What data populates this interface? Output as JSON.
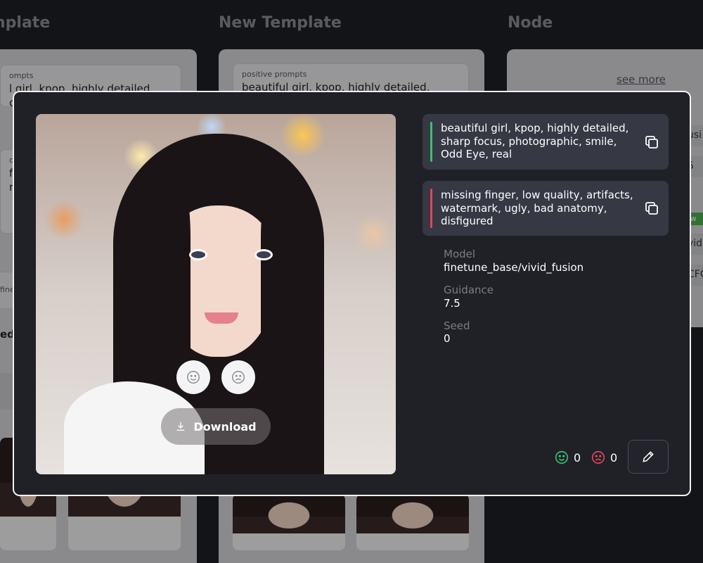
{
  "columns": {
    "col1_title": "nplate",
    "col2_title": "New Template",
    "col3_title": "Node",
    "col1_field1_label": "ompts",
    "col1_field1_value": "l girl, kpop, highly detailed,",
    "col1_field1_value2": "cus",
    "col1_field2_label": "om",
    "col1_field2_value": "fin",
    "col1_field2_value2": "rk,",
    "col1_field3_label": "fine",
    "col1_bold_label": "ed",
    "col2_field1_label": "positive prompts",
    "col2_field1_value": "beautiful girl, kpop, highly detailed,",
    "col3_see_more": "see more",
    "col3_pill1": "usi",
    "col3_pill2": "5",
    "col3_new_badge": "ew",
    "col3_pill3": "vid",
    "col3_pill4": "CFC"
  },
  "modal": {
    "positive_prompt": "beautiful girl, kpop, highly detailed, sharp focus, photographic, smile, Odd Eye, real",
    "negative_prompt": "missing finger, low quality, artifacts, watermark, ugly, bad anatomy, disfigured",
    "model_label": "Model",
    "model_value": "finetune_base/vivid_fusion",
    "guidance_label": "Guidance",
    "guidance_value": "7.5",
    "seed_label": "Seed",
    "seed_value": "0",
    "download_label": "Download",
    "like_count": "0",
    "dislike_count": "0"
  },
  "icons": {
    "happy": "smile-face-icon",
    "sad": "sad-face-icon",
    "download": "download-icon",
    "copy": "copy-icon",
    "edit": "pencil-icon"
  },
  "colors": {
    "like": "#3fbf6e",
    "dislike": "#e0465a"
  }
}
